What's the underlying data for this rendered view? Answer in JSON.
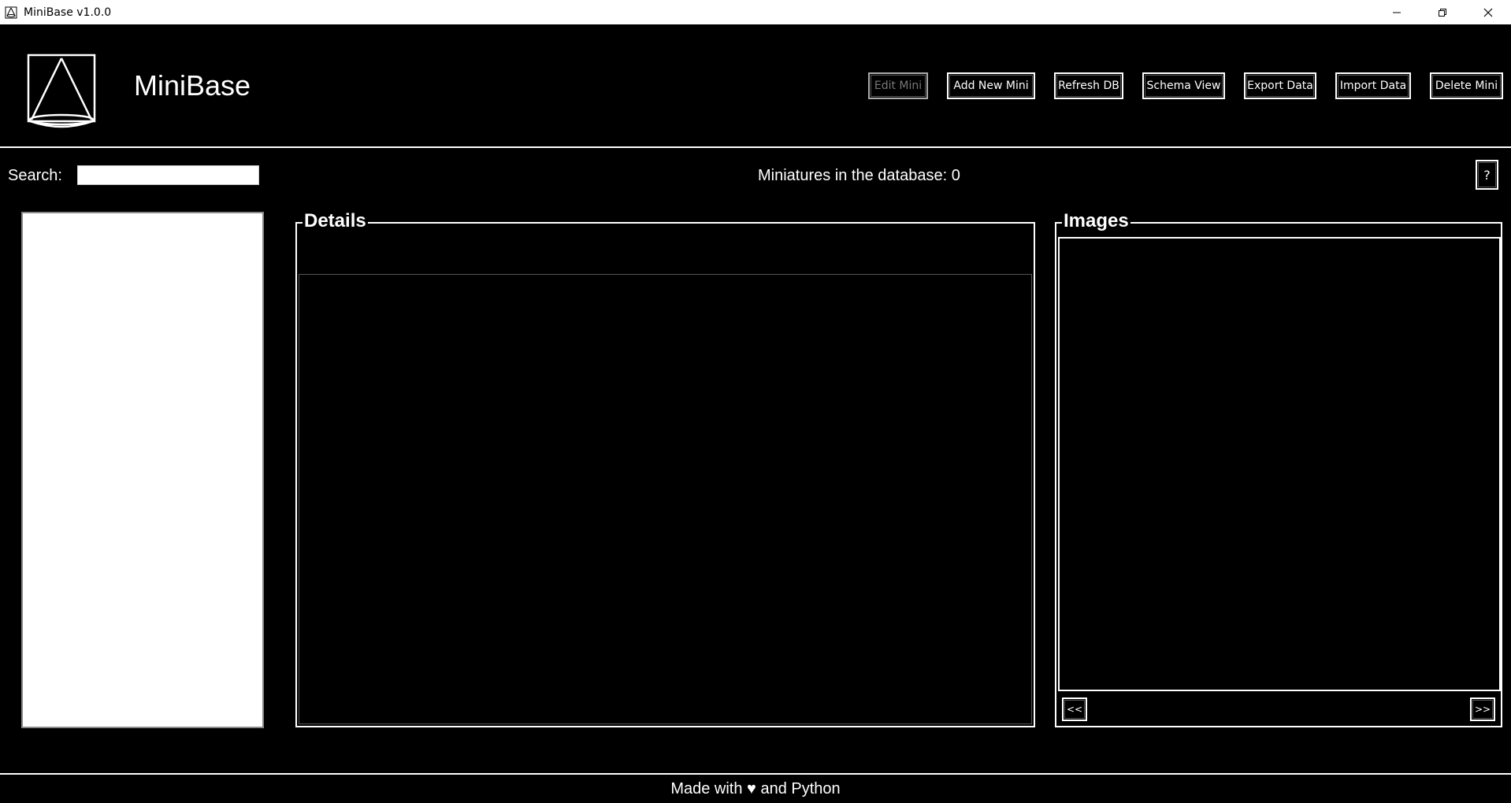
{
  "window": {
    "title": "MiniBase v1.0.0",
    "controls": [
      "minimize",
      "restore",
      "close"
    ]
  },
  "header": {
    "app_name": "MiniBase",
    "buttons": [
      {
        "label": "Edit Mini",
        "enabled": false
      },
      {
        "label": "Add New Mini",
        "enabled": true
      },
      {
        "label": "Refresh DB",
        "enabled": true
      },
      {
        "label": "Schema View",
        "enabled": true
      },
      {
        "label": "Export Data",
        "enabled": true
      },
      {
        "label": "Import Data",
        "enabled": true
      },
      {
        "label": "Delete Mini",
        "enabled": true
      }
    ]
  },
  "search": {
    "label": "Search:",
    "value": ""
  },
  "status": {
    "count_text": "Miniatures in the database: 0"
  },
  "help": {
    "label": "?"
  },
  "miniature_list": {
    "items": []
  },
  "details": {
    "title": "Details"
  },
  "images": {
    "title": "Images",
    "prev_label": "<<",
    "next_label": ">>"
  },
  "footer": {
    "text": "Made with ♥ and Python"
  },
  "colors": {
    "background": "#000000",
    "foreground": "#ffffff",
    "disabled_text": "#777777"
  }
}
